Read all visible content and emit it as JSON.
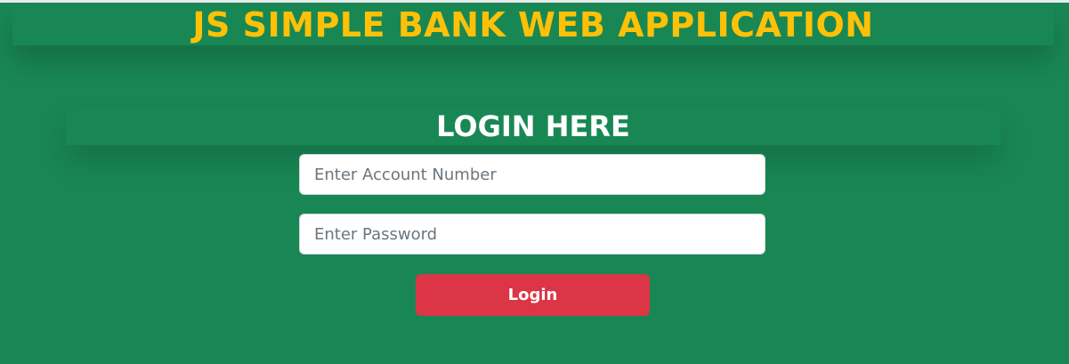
{
  "header": {
    "title": "JS SIMPLE BANK WEB APPLICATION"
  },
  "login": {
    "heading": "LOGIN HERE",
    "account_field": {
      "value": "",
      "placeholder": "Enter Account Number"
    },
    "password_field": {
      "value": "",
      "placeholder": "Enter Password"
    },
    "submit_label": "Login"
  },
  "colors": {
    "background": "#198754",
    "title": "#ffc107",
    "heading": "#ffffff",
    "button": "#dc3545"
  }
}
